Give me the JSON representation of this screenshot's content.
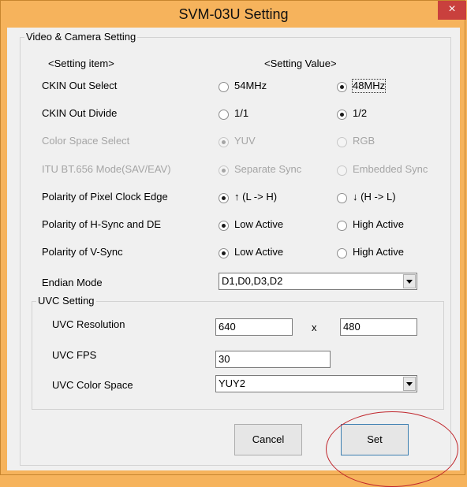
{
  "window": {
    "title": "SVM-03U Setting",
    "close_label": "×"
  },
  "video_group": {
    "legend": "Video & Camera Setting",
    "header_item": "<Setting item>",
    "header_value": "<Setting Value>",
    "rows": [
      {
        "label": "CKIN Out Select",
        "opt1": "54MHz",
        "opt2": "48MHz",
        "selected": 2,
        "enabled": true
      },
      {
        "label": "CKIN Out Divide",
        "opt1": "1/1",
        "opt2": "1/2",
        "selected": 2,
        "enabled": true
      },
      {
        "label": "Color Space Select",
        "opt1": "YUV",
        "opt2": "RGB",
        "selected": 1,
        "enabled": false
      },
      {
        "label": "ITU BT.656 Mode(SAV/EAV)",
        "opt1": "Separate Sync",
        "opt2": "Embedded Sync",
        "selected": 1,
        "enabled": false
      },
      {
        "label": "Polarity of Pixel Clock Edge",
        "opt1": "↑ (L -> H)",
        "opt2": "↓ (H -> L)",
        "selected": 1,
        "enabled": true
      },
      {
        "label": "Polarity of H-Sync and DE",
        "opt1": "Low Active",
        "opt2": "High Active",
        "selected": 1,
        "enabled": true
      },
      {
        "label": "Polarity of V-Sync",
        "opt1": "Low Active",
        "opt2": "High Active",
        "selected": 1,
        "enabled": true
      }
    ],
    "endian_label": "Endian Mode",
    "endian_value": "D1,D0,D3,D2"
  },
  "uvc_group": {
    "legend": "UVC Setting",
    "resolution_label": "UVC Resolution",
    "width": "640",
    "x_label": "x",
    "height": "480",
    "fps_label": "UVC FPS",
    "fps": "30",
    "color_space_label": "UVC Color Space",
    "color_space": "YUY2"
  },
  "buttons": {
    "cancel": "Cancel",
    "set": "Set"
  },
  "colors": {
    "frame": "#f6b35c",
    "close": "#c9403d",
    "annotation_circle": "#c0262c"
  }
}
